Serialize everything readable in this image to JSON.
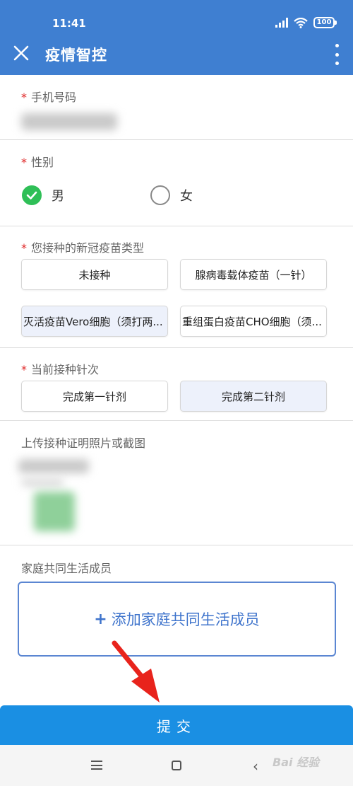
{
  "status_bar": {
    "time": "11:41",
    "battery": "100"
  },
  "header": {
    "title": "疫情智控"
  },
  "form": {
    "required_mark": "*",
    "phone": {
      "label": "手机号码"
    },
    "gender": {
      "label": "性别",
      "options": [
        "男",
        "女"
      ],
      "selected": "男"
    },
    "vaccine_type": {
      "label": "您接种的新冠疫苗类型",
      "options": [
        "未接种",
        "腺病毒载体疫苗（一针）",
        "灭活疫苗Vero细胞（须打两...",
        "重组蛋白疫苗CHO细胞（须..."
      ]
    },
    "dose": {
      "label": "当前接种针次",
      "options": [
        "完成第一针剂",
        "完成第二针剂"
      ]
    },
    "upload": {
      "label": "上传接种证明照片或截图"
    },
    "family": {
      "label": "家庭共同生活成员",
      "add_button_plus": "+",
      "add_button_text": "添加家庭共同生活成员"
    }
  },
  "submit": {
    "label": "提交"
  },
  "watermark": "Bai 经验",
  "colors": {
    "header": "#3f7fd1",
    "submit": "#1a8fe3",
    "required": "#e02a2a",
    "check": "#2fbf57",
    "add_border": "#5b86d2",
    "arrow": "#e8231c"
  },
  "icons": {
    "close": "close-icon",
    "more": "more-vert-icon",
    "check": "check-icon",
    "back": "chevron-left-icon"
  }
}
